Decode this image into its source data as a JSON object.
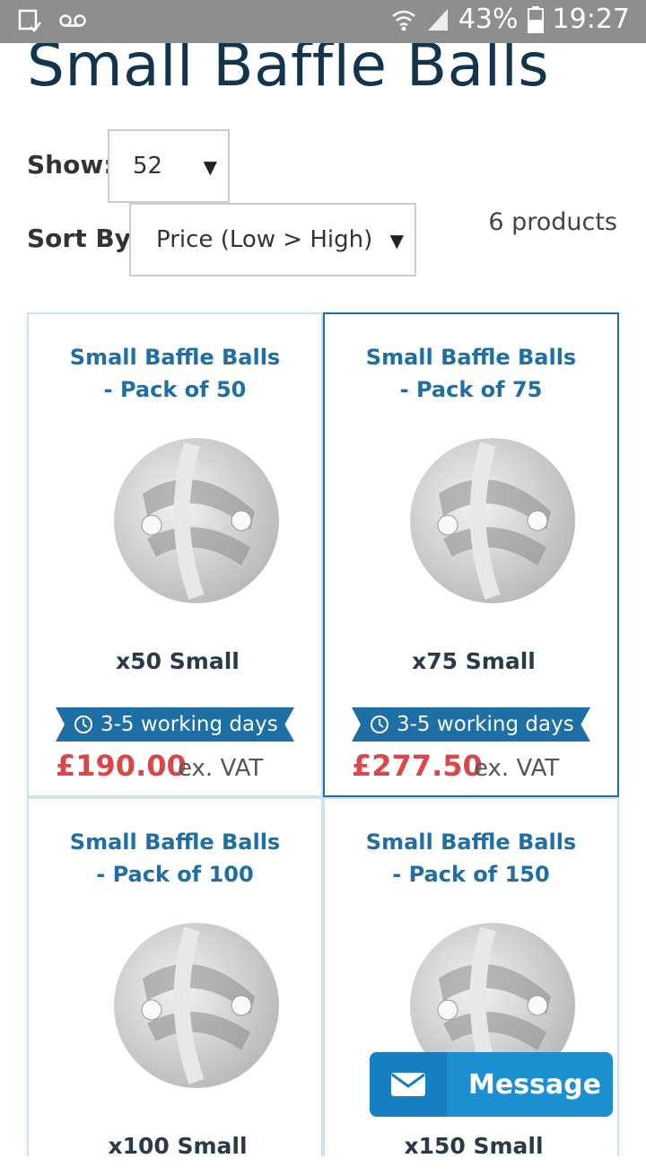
{
  "status_bar": {
    "battery": "43%",
    "time": "19:27",
    "icons": [
      "notification-icon",
      "voicemail-icon",
      "wifi-icon",
      "signal-icon",
      "battery-icon"
    ]
  },
  "page": {
    "title": "Small Baffle Balls",
    "show_label": "Show:",
    "show_value": "52",
    "sort_label": "Sort By:",
    "sort_value": "Price (Low > High)",
    "product_count": "6 products"
  },
  "products": [
    {
      "title": "Small Baffle Balls - Pack of 50",
      "caption": "x50 Small",
      "delivery": "3-5 working days",
      "price": "£190.00",
      "vat": "ex. VAT"
    },
    {
      "title": "Small Baffle Balls - Pack of 75",
      "caption": "x75 Small",
      "delivery": "3-5 working days",
      "price": "£277.50",
      "vat": "ex. VAT"
    },
    {
      "title": "Small Baffle Balls - Pack of 100",
      "caption": "x100 Small"
    },
    {
      "title": "Small Baffle Balls - Pack of 150",
      "caption": "x150 Small"
    }
  ],
  "message_button": {
    "label": "Message"
  },
  "colors": {
    "accent": "#1d6fa5",
    "price": "#d9474b",
    "title": "#12344d",
    "message": "#1b8fd0"
  }
}
